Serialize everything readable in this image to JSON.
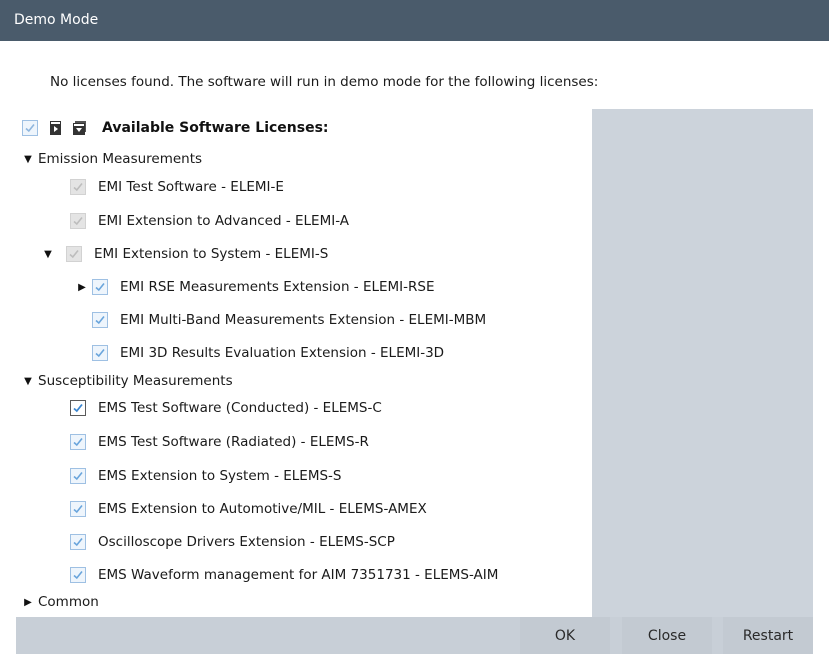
{
  "window": {
    "title": "Demo Mode"
  },
  "message": "No licenses found. The software will run in demo mode for the following licenses:",
  "tree": {
    "header_label": "Available Software Licenses:",
    "sections": [
      {
        "label": "Emission Measurements",
        "items": [
          {
            "label": "EMI Test Software  -  ELEMI-E"
          },
          {
            "label": "EMI Extension to Advanced  -  ELEMI-A"
          },
          {
            "label": "EMI Extension to System  -  ELEMI-S"
          },
          {
            "label": "EMI RSE Measurements Extension  -  ELEMI-RSE"
          },
          {
            "label": "EMI Multi-Band Measurements Extension  -  ELEMI-MBM"
          },
          {
            "label": "EMI 3D Results Evaluation Extension  -  ELEMI-3D"
          }
        ]
      },
      {
        "label": "Susceptibility Measurements",
        "items": [
          {
            "label": "EMS Test Software (Conducted)  -  ELEMS-C"
          },
          {
            "label": "EMS Test Software (Radiated)  -  ELEMS-R"
          },
          {
            "label": "EMS Extension to System  -  ELEMS-S"
          },
          {
            "label": "EMS Extension to Automotive/MIL  -  ELEMS-AMEX"
          },
          {
            "label": "Oscilloscope Drivers Extension  -  ELEMS-SCP"
          },
          {
            "label": "EMS Waveform management for AIM 7351731  -  ELEMS-AIM"
          }
        ]
      },
      {
        "label": "Common"
      }
    ]
  },
  "buttons": {
    "ok": "OK",
    "close": "Close",
    "restart": "Restart"
  },
  "colors": {
    "titlebar": "#4a5b6b",
    "panel": "#ccd3db",
    "check_blue": "#6aa5dc"
  }
}
